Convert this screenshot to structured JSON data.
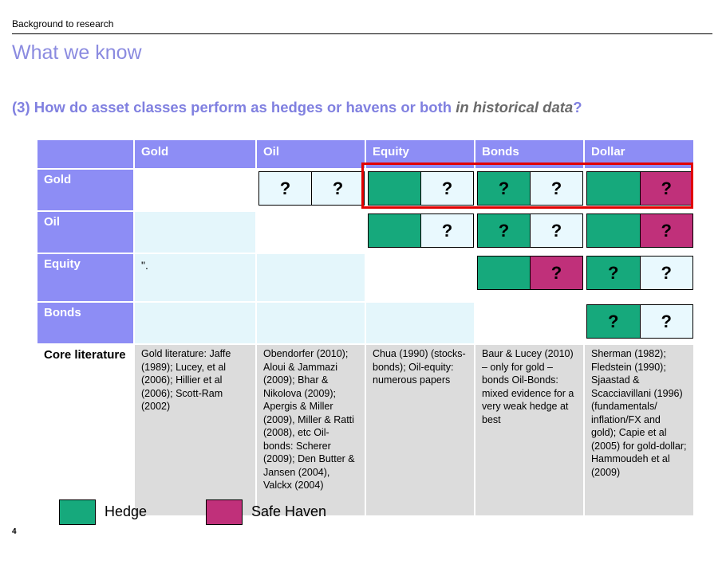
{
  "header": {
    "section": "Background to research",
    "title": "What we know"
  },
  "question": {
    "main": "(3) How do asset classes perform as hedges or havens or both ",
    "emphasis": "in historical data",
    "end": "?"
  },
  "table": {
    "columns": [
      "Gold",
      "Oil",
      "Equity",
      "Bonds",
      "Dollar"
    ],
    "rows": [
      "Gold",
      "Oil",
      "Equity",
      "Bonds"
    ],
    "unknown_mark": "?",
    "equity_gold_note": "\".",
    "literature_label": "Core literature",
    "literature": [
      "Gold literature: Jaffe (1989); Lucey, et al (2006); Hillier et al (2006); Scott-Ram (2002)",
      "Obendorfer (2010); Aloui & Jammazi (2009); Bhar & Nikolova (2009); Apergis & Miller (2009), Miller & Ratti (2008), etc Oil-bonds: Scherer (2009); Den Butter & Jansen (2004), Valckx (2004)",
      "Chua (1990) (stocks-bonds); Oil-equity: numerous papers",
      "Baur & Lucey (2010) – only for gold – bonds Oil-Bonds: mixed evidence for a very weak hedge at best",
      "Sherman (1982); Fledstein (1990); Sjaastad & Scacciavillani (1996) (fundamentals/ inflation/FX and gold); Capie et al (2005) for gold-dollar; Hammoudeh et al (2009)"
    ]
  },
  "legend": {
    "hedge": "Hedge",
    "safe_haven": "Safe Haven"
  },
  "colors": {
    "header": "#8d8df5",
    "hedge": "#16a97c",
    "safe_haven": "#c0307a",
    "highlight": "#e20000"
  },
  "page_number": "4"
}
